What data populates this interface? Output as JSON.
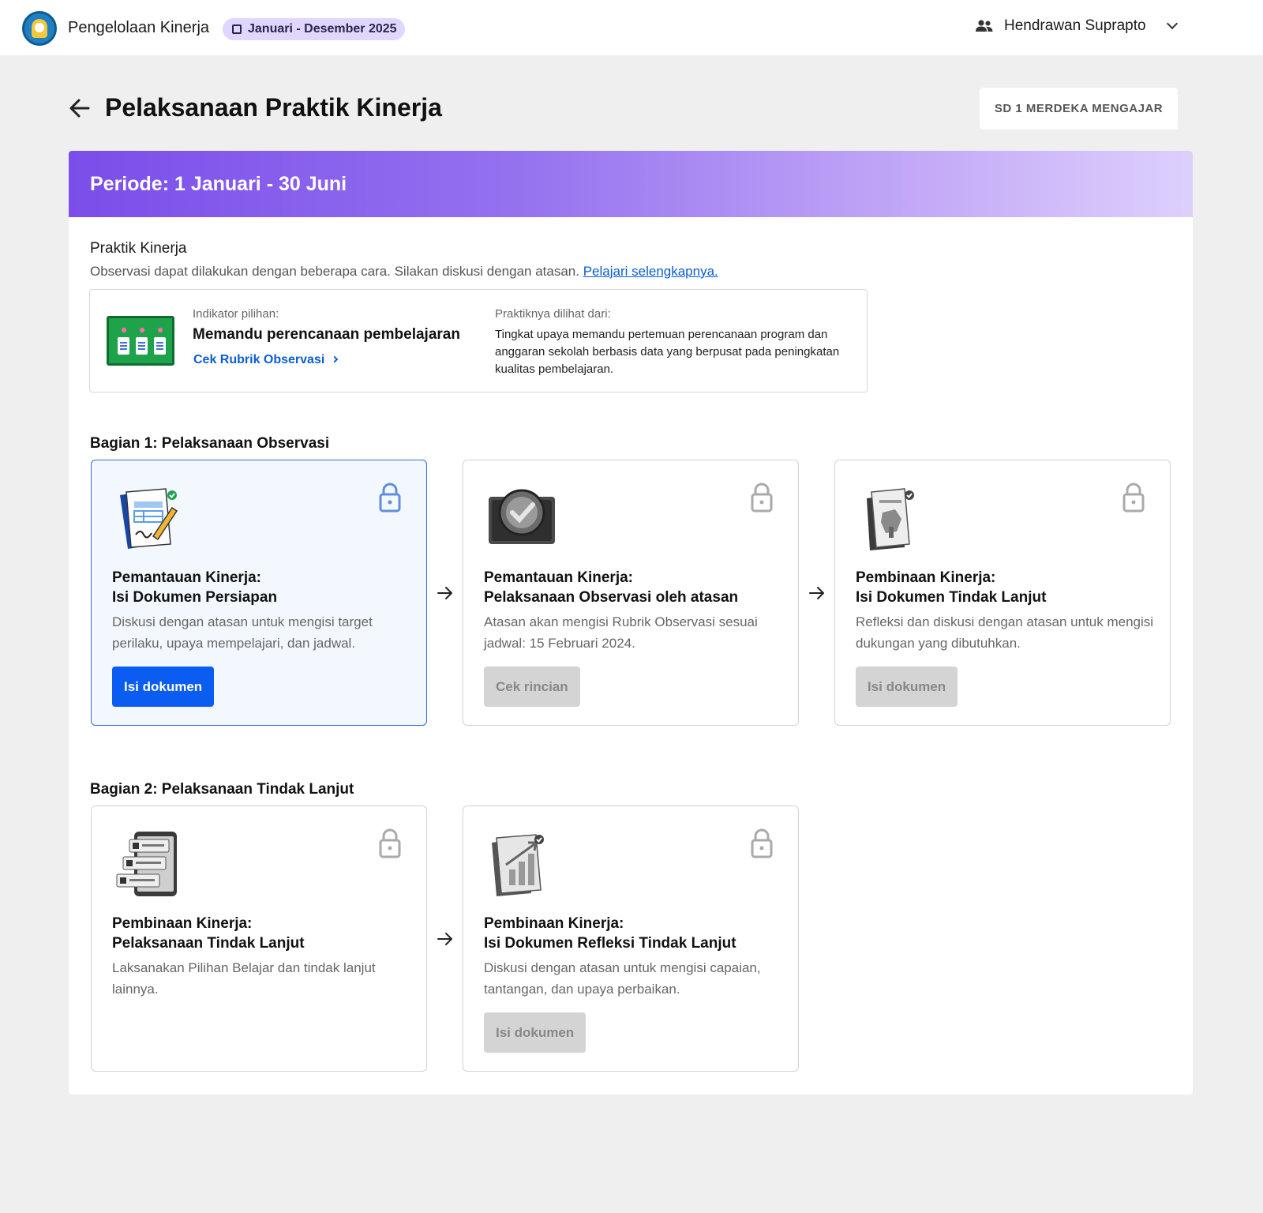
{
  "topbar": {
    "app_title": "Pengelolaan Kinerja",
    "period": "Januari - Desember 2025",
    "user_name": "Hendrawan Suprapto"
  },
  "header": {
    "title": "Pelaksanaan Praktik Kinerja",
    "school": "SD 1 MERDEKA MENGAJAR"
  },
  "banner": {
    "period": "Periode: 1 Januari - 30 Juni"
  },
  "praktik": {
    "title": "Praktik Kinerja",
    "desc": "Observasi dapat dilakukan dengan beberapa cara. Silakan diskusi dengan atasan.",
    "link": "Pelajari selengkapnya.",
    "indicator_label": "Indikator pilihan:",
    "indicator_value": "Memandu perencanaan pembelajaran",
    "rubric_link": "Cek Rubrik Observasi",
    "seen_label": "Praktiknya dilihat dari:",
    "seen_value": "Tingkat upaya memandu pertemuan perencanaan program dan anggaran sekolah berbasis data yang berpusat pada peningkatan kualitas pembelajaran."
  },
  "section1": {
    "title": "Bagian 1: Pelaksanaan Observasi",
    "steps": [
      {
        "title_line1": "Pemantauan Kinerja:",
        "title_line2": "Isi Dokumen Persiapan",
        "desc": "Diskusi dengan atasan untuk mengisi target perilaku, upaya mempelajari, dan jadwal.",
        "button": "Isi dokumen"
      },
      {
        "title_line1": "Pemantauan Kinerja:",
        "title_line2": "Pelaksanaan Observasi oleh atasan",
        "desc": "Atasan akan mengisi Rubrik Observasi sesuai jadwal: 15 Februari 2024.",
        "button": "Cek rincian"
      },
      {
        "title_line1": "Pembinaan Kinerja:",
        "title_line2": "Isi Dokumen Tindak Lanjut",
        "desc": "Refleksi dan diskusi dengan atasan untuk mengisi dukungan yang dibutuhkan.",
        "button": "Isi dokumen"
      }
    ]
  },
  "section2": {
    "title": "Bagian 2: Pelaksanaan Tindak Lanjut",
    "steps": [
      {
        "title_line1": "Pembinaan Kinerja:",
        "title_line2": "Pelaksanaan Tindak Lanjut",
        "desc": "Laksanakan Pilihan Belajar dan tindak lanjut lainnya."
      },
      {
        "title_line1": "Pembinaan Kinerja:",
        "title_line2": "Isi Dokumen Refleksi Tindak Lanjut",
        "desc": "Diskusi dengan atasan untuk mengisi capaian, tantangan, dan upaya perbaikan.",
        "button": "Isi dokumen"
      }
    ]
  },
  "colors": {
    "primary": "#0b5cf0",
    "link": "#0b5cd5",
    "banner_start": "#7b4dea",
    "banner_end": "#ddd0fc",
    "pill_bg": "#e0d6ff"
  }
}
